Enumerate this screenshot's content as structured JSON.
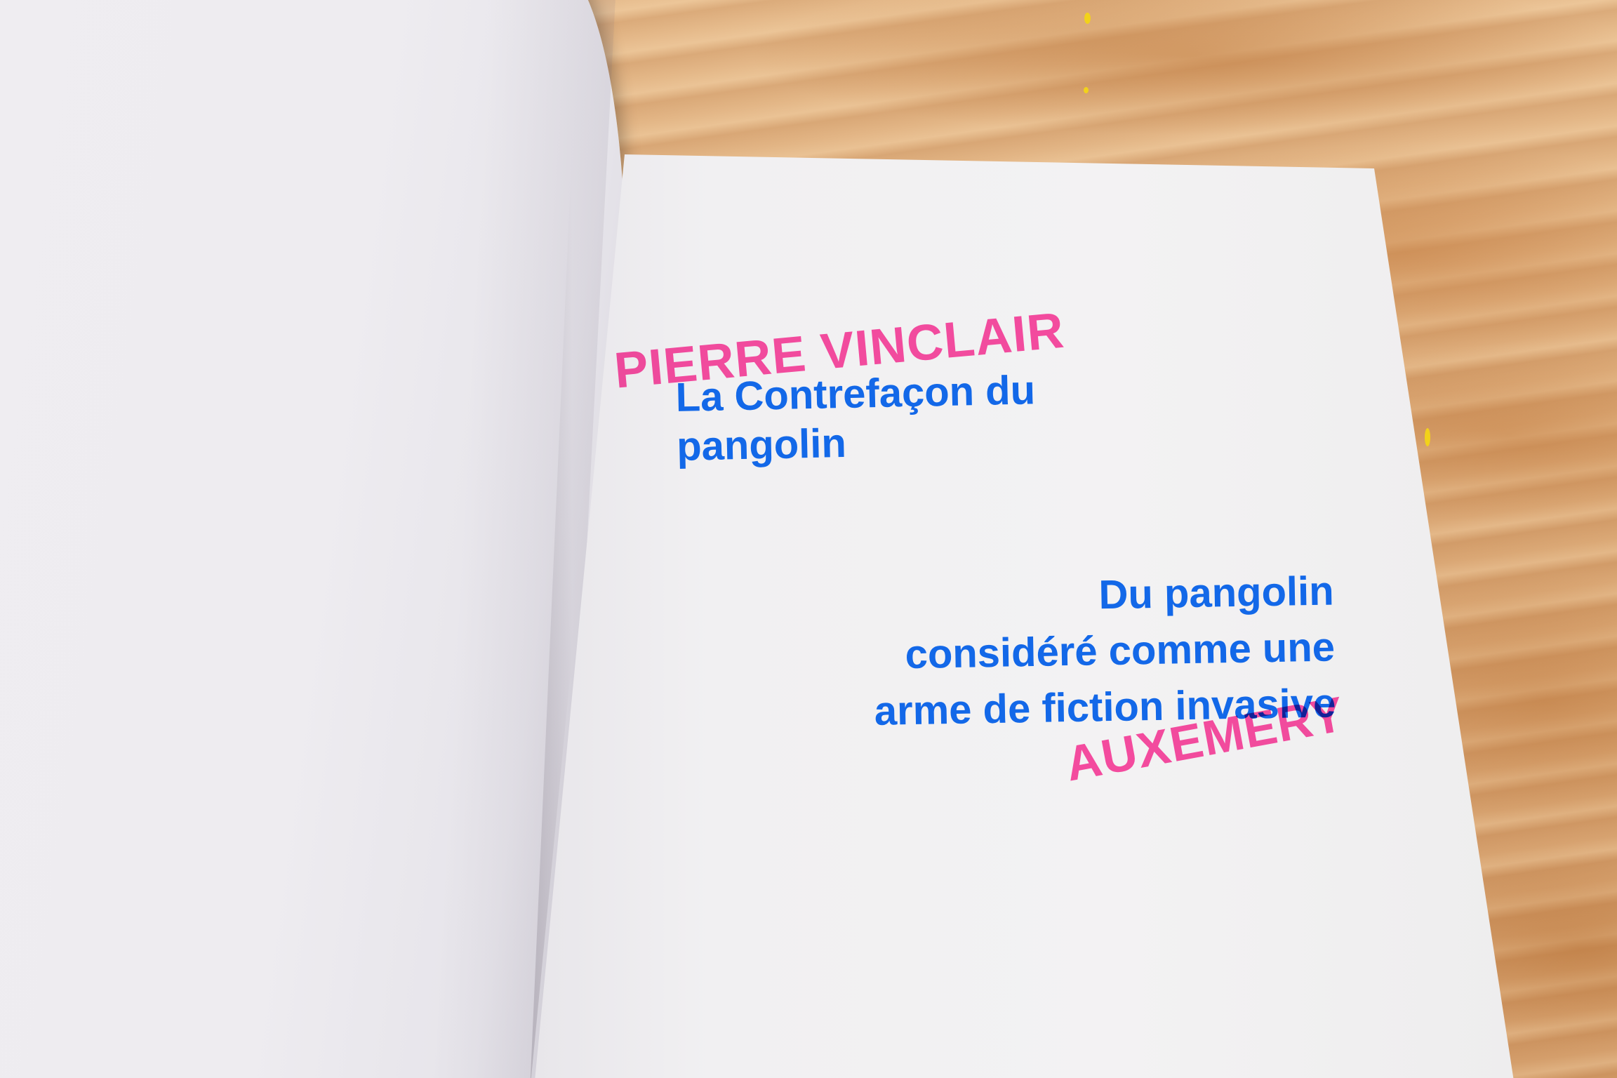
{
  "book": {
    "author": "PIERRE VINCLAIR",
    "title_lines": [
      "La Contrefaçon du",
      "pangolin"
    ],
    "subtitle_lines": [
      "Du pangolin",
      "considéré comme une",
      "arme de fiction invasive"
    ],
    "publisher": "AUXEMERY"
  },
  "colors": {
    "pink_ink": "#ff4fa6",
    "blue_ink": "#1368e8",
    "paper": "#f2f1f3",
    "wood": "#dcaa78"
  }
}
